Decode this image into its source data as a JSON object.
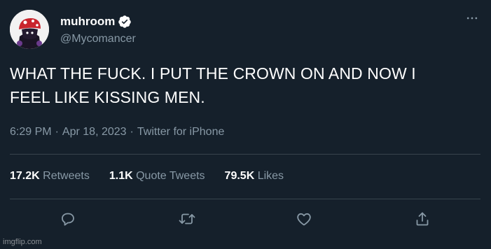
{
  "user": {
    "display_name": "muhroom",
    "handle": "@Mycomancer",
    "verified": true
  },
  "tweet": {
    "line1": "WHAT THE FUCK. I PUT THE CROWN ON AND NOW I",
    "line2": "FEEL LIKE KISSING MEN.",
    "time": "6:29 PM",
    "dot1": "·",
    "date": "Apr 18, 2023",
    "dot2": "·",
    "source": "Twitter for iPhone"
  },
  "stats": {
    "retweets_count": "17.2K",
    "retweets_label": "Retweets",
    "quotes_count": "1.1K",
    "quotes_label": "Quote Tweets",
    "likes_count": "79.5K",
    "likes_label": "Likes"
  },
  "icons": {
    "reply": "reply-icon",
    "retweet": "retweet-icon",
    "like": "heart-icon",
    "share": "share-icon",
    "more": "more-icon",
    "verified": "verified-badge-icon"
  },
  "colors": {
    "background": "#15202b",
    "text": "#ffffff",
    "secondary": "#8899a6",
    "divider": "#38444d"
  },
  "watermark": "imgflip.com"
}
